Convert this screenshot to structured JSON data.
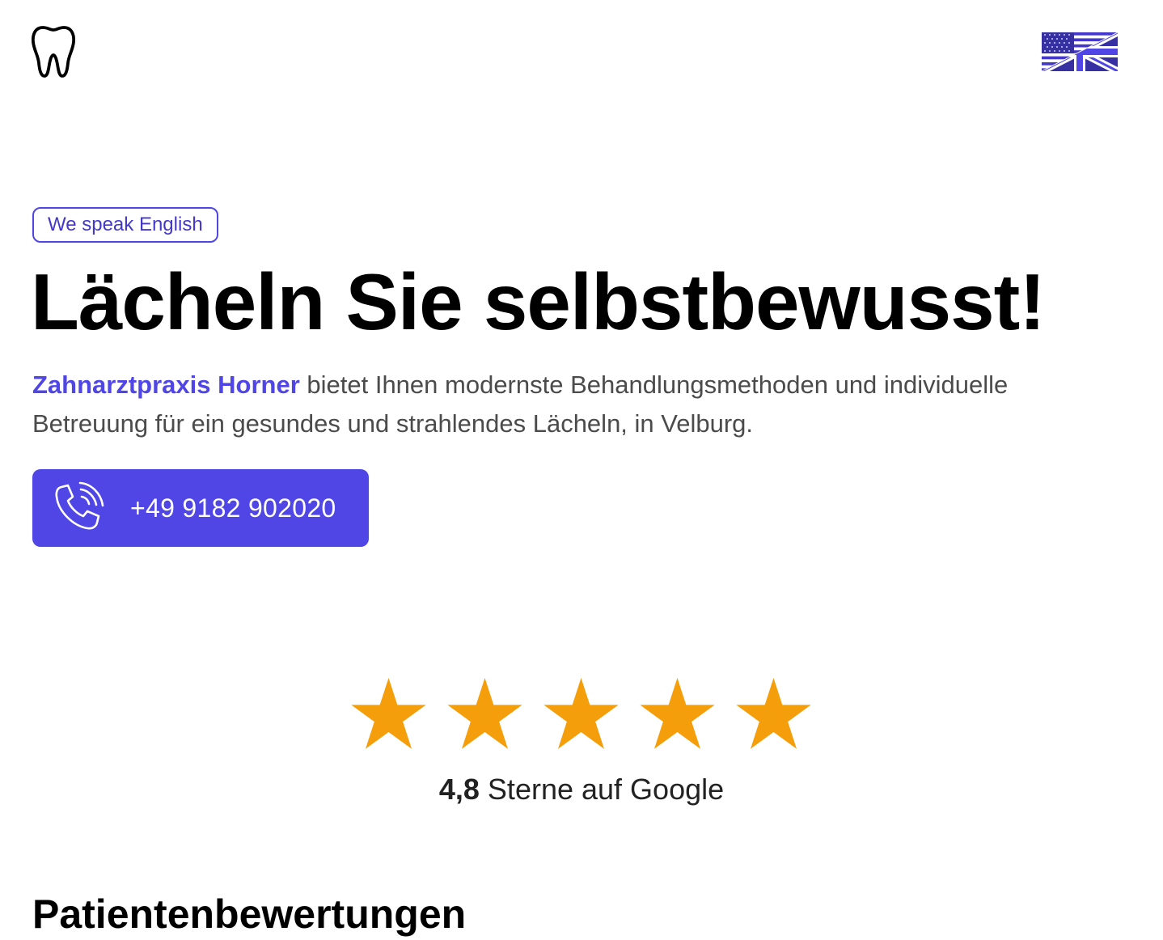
{
  "header": {
    "logo_icon": "tooth-icon",
    "language_icon": "us-uk-flag-icon"
  },
  "hero": {
    "badge": "We speak English",
    "title": "Lächeln Sie selbstbewusst!",
    "brand_name": "Zahnarztpraxis Horner",
    "description": " bietet Ihnen modernste Behandlungsmethoden und individuelle Betreuung für ein gesundes und strahlendes Lächeln, in Velburg.",
    "phone_icon": "phone-ringing-icon",
    "phone": "+49 9182 902020"
  },
  "rating": {
    "stars_filled": 5,
    "stars_total": 5,
    "star_icon": "star-icon",
    "value": "4,8",
    "label": " Sterne auf Google"
  },
  "reviews": {
    "title": "Patientenbewertungen"
  },
  "colors": {
    "accent": "#4f46e5",
    "star": "#f59e0b",
    "text": "#000000",
    "muted": "#4b4b4b"
  }
}
